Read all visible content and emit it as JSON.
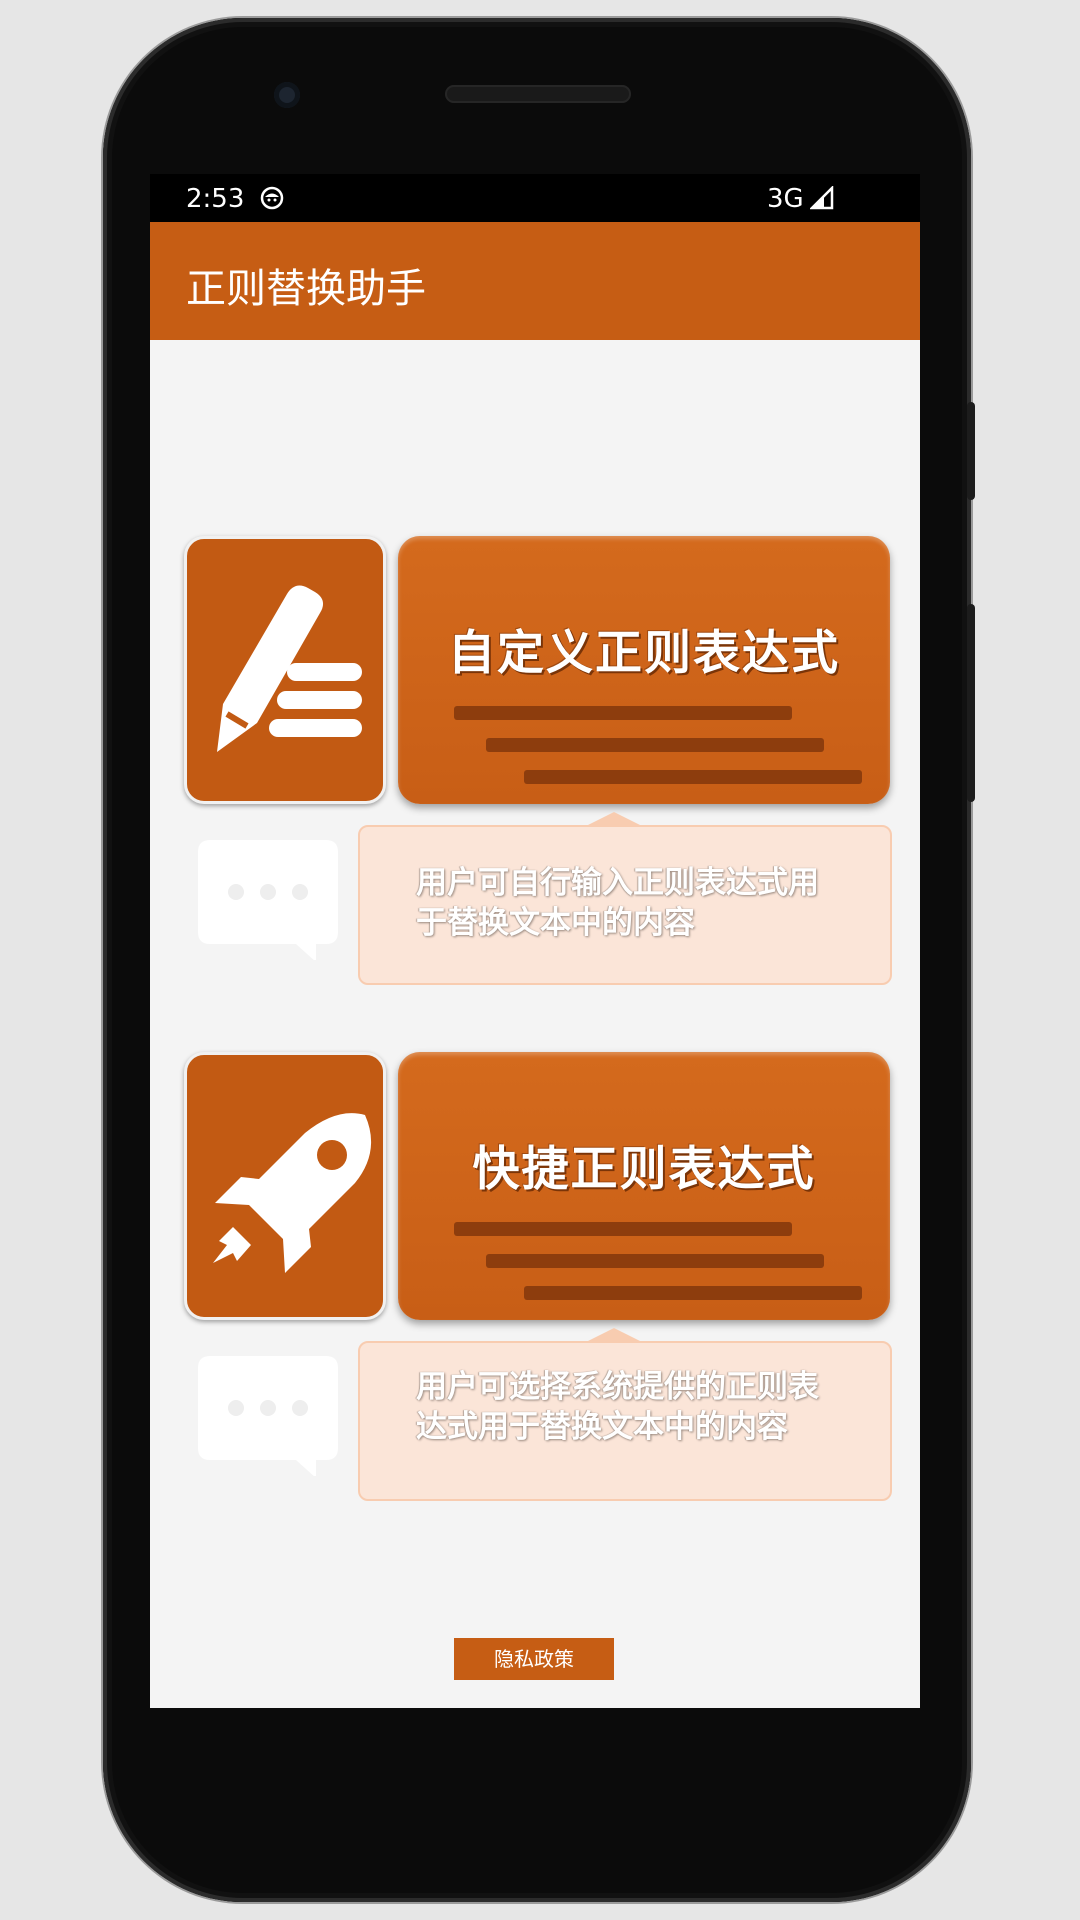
{
  "status_bar": {
    "time": "2:53",
    "network": "3G"
  },
  "app_bar": {
    "title": "正则替换助手"
  },
  "cards": [
    {
      "title": "自定义正则表达式",
      "icon": "pencil-list-icon",
      "description": "用户可自行输入正则表达式用于替换文本中的内容"
    },
    {
      "title": "快捷正则表达式",
      "icon": "rocket-icon",
      "description": "用户可选择系统提供的正则表达式用于替换文本中的内容"
    }
  ],
  "privacy_button": {
    "label": "隐私政策"
  },
  "colors": {
    "accent": "#c65d14",
    "background": "#f4f4f4"
  }
}
